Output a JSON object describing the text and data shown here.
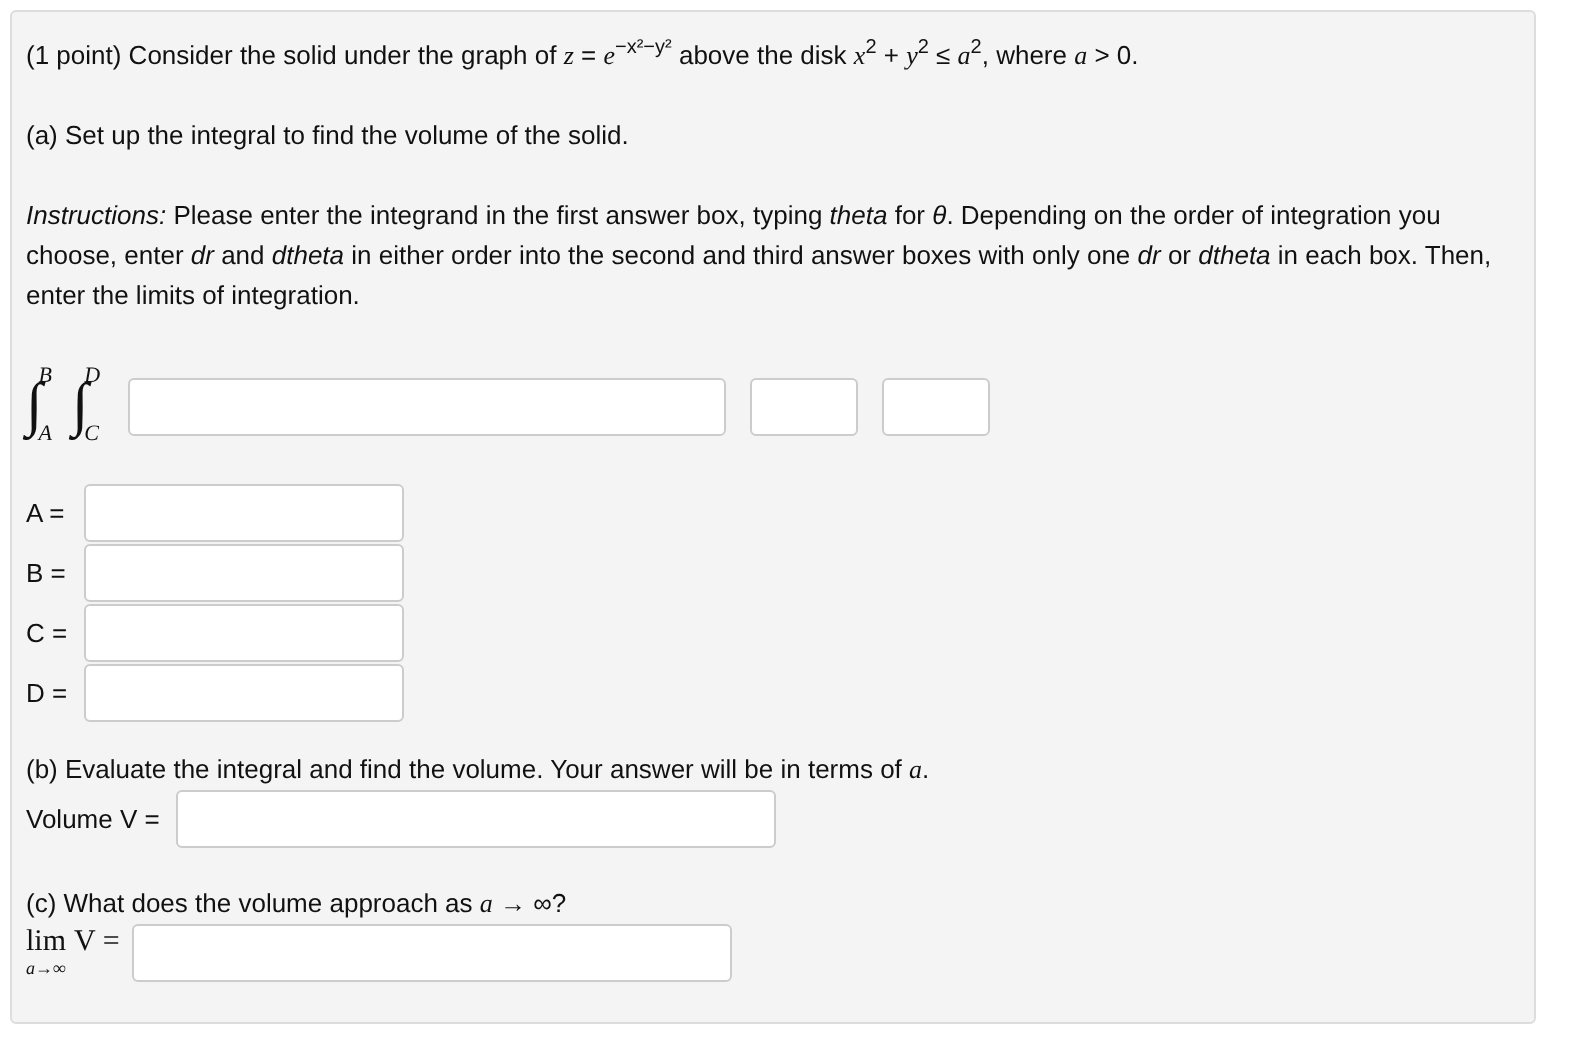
{
  "problem": {
    "intro": "(1 point) Consider the solid under the graph of *z* = *e*$^{−x²−y²}$ above the disk *x*$^{2}$ + *y*$^{2}$ ≤ *a*$^{2}$, where *a* > 0.",
    "part_a": {
      "question": "(a) Set up the integral to find the volume of the solid.",
      "instructions": "*Instructions:* Please enter the integrand in the first answer box, typing *theta* for *θ*. Depending on the order of integration you choose, enter *dr* and *dtheta* in either order into the second and third answer boxes with only one *dr* or *dtheta* in each box. Then, enter the limits of integration.",
      "integrals": [
        {
          "sign": "∫",
          "upper": "B",
          "lower": "A"
        },
        {
          "sign": "∫",
          "upper": "D",
          "lower": "C"
        }
      ],
      "answer_boxes": [
        {
          "kind": "integrand"
        },
        {
          "kind": "differential"
        },
        {
          "kind": "differential"
        }
      ],
      "limits": [
        {
          "label": "A ="
        },
        {
          "label": "B ="
        },
        {
          "label": "C ="
        },
        {
          "label": "D ="
        }
      ]
    },
    "part_b": {
      "question": "(b) Evaluate the integral and find the volume. Your answer will be in terms of *a*.",
      "field_label": "Volume V ="
    },
    "part_c": {
      "question": "(c) What does the volume approach as *a* → ∞?",
      "operator": "lim",
      "subscript": "a→∞",
      "expression": "V ="
    }
  }
}
